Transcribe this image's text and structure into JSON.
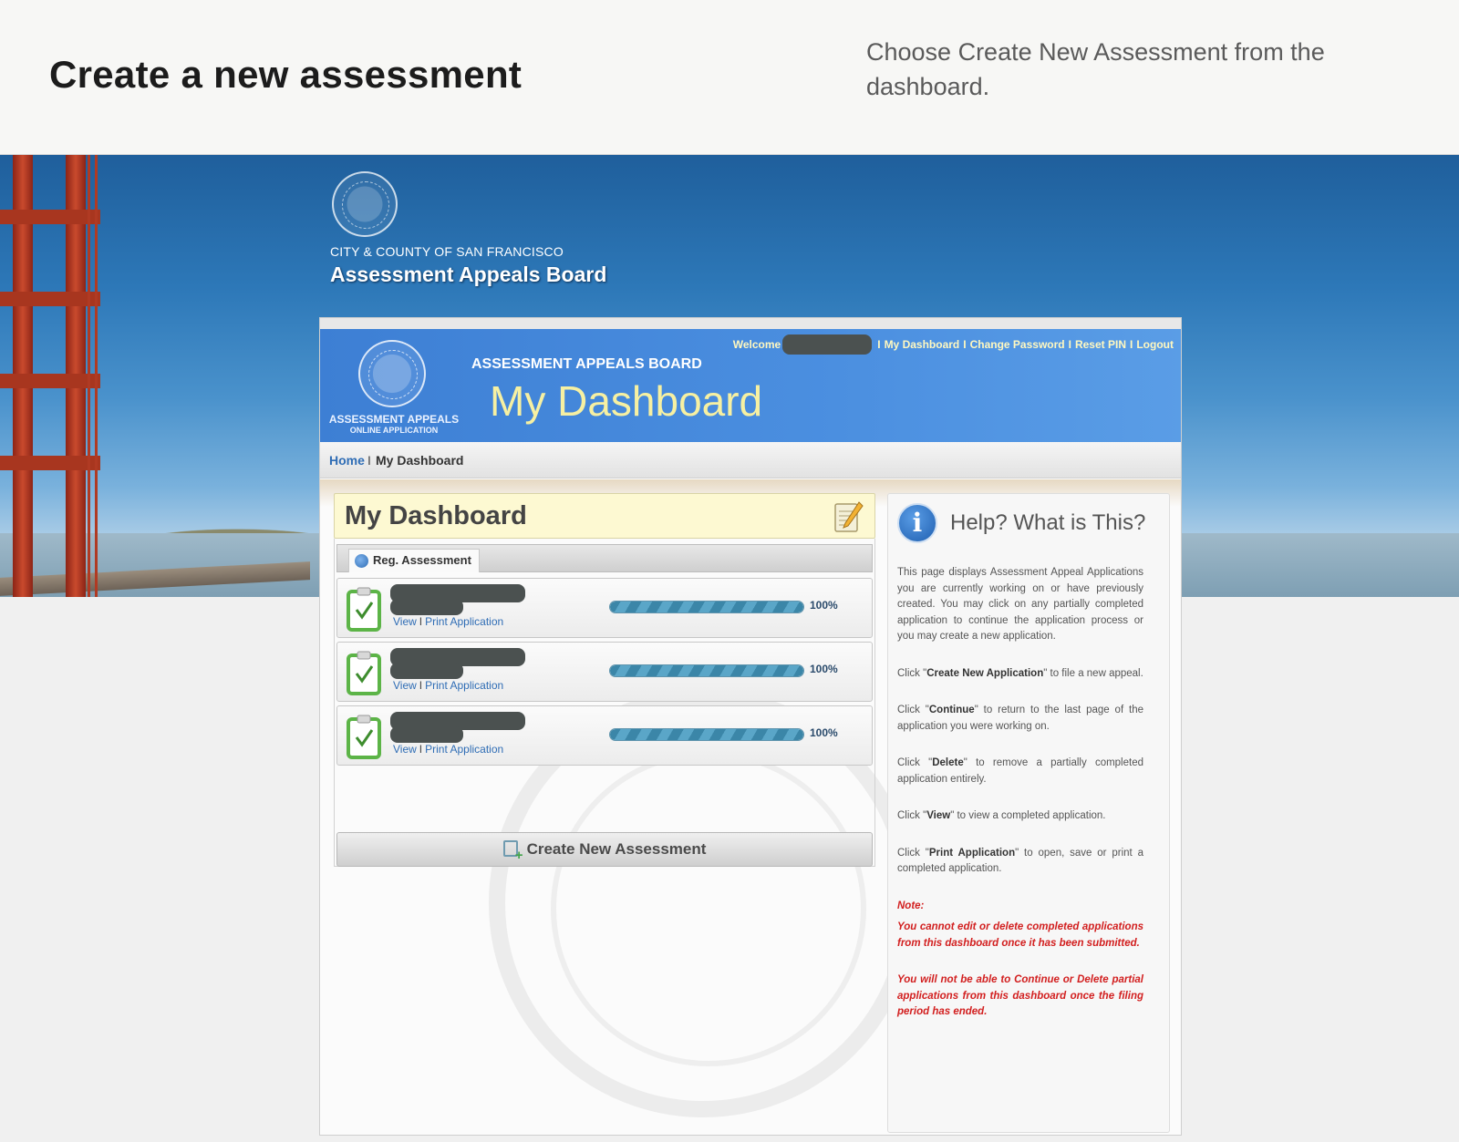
{
  "guide": {
    "title": "Create a new assessment",
    "description": "Choose Create New Assessment from the dashboard."
  },
  "banner": {
    "city": "CITY & COUNTY OF SAN FRANCISCO",
    "board": "Assessment Appeals Board"
  },
  "header": {
    "org_line1": "ASSESSMENT APPEALS",
    "org_line2": "ONLINE APPLICATION",
    "subtitle": "ASSESSMENT APPEALS BOARD",
    "title": "My Dashboard",
    "nav": {
      "welcome": "Welcome",
      "my_dashboard": "My Dashboard",
      "change_password": "Change Password",
      "reset_pin": "Reset PIN",
      "logout": "Logout",
      "separator": "I"
    }
  },
  "breadcrumb": {
    "home": "Home",
    "separator": "I",
    "current": "My Dashboard"
  },
  "dashboard": {
    "title": "My Dashboard",
    "tab": "Reg. Assessment",
    "rows": [
      {
        "view": "View",
        "print": "Print Application",
        "progress": 100,
        "progress_label": "100%"
      },
      {
        "view": "View",
        "print": "Print Application",
        "progress": 100,
        "progress_label": "100%"
      },
      {
        "view": "View",
        "print": "Print Application",
        "progress": 100,
        "progress_label": "100%"
      }
    ],
    "create_button": "Create New Assessment"
  },
  "help": {
    "title": "Help? What is This?",
    "intro": "This page displays Assessment Appeal Applications you are currently working on or have previously created. You may click on any partially completed application to continue the application process or you may create a new application.",
    "p1_pre": "Click \"",
    "p1_bold": "Create New Application",
    "p1_post": "\" to file a new appeal.",
    "p2_pre": "Click \"",
    "p2_bold": "Continue",
    "p2_post": "\" to return to the last page of the application you were working on.",
    "p3_pre": "Click \"",
    "p3_bold": "Delete",
    "p3_post": "\" to remove a partially completed application entirely.",
    "p4_pre": "Click \"",
    "p4_bold": "View",
    "p4_post": "\" to view a completed application.",
    "p5_pre": "Click \"",
    "p5_bold": "Print Application",
    "p5_post": "\" to open, save or print a completed application.",
    "note_label": "Note:",
    "note1": "You cannot edit or delete completed applications from this dashboard once it has been submitted.",
    "note2": "You will not be able to Continue or Delete partial applications from this dashboard once the filing period has ended."
  },
  "colors": {
    "header_blue": "#4b8fe0",
    "title_yellow": "#f6f0a2",
    "link_blue": "#2f6db5",
    "note_red": "#d21f1f",
    "progress_teal": "#3b86a8"
  }
}
